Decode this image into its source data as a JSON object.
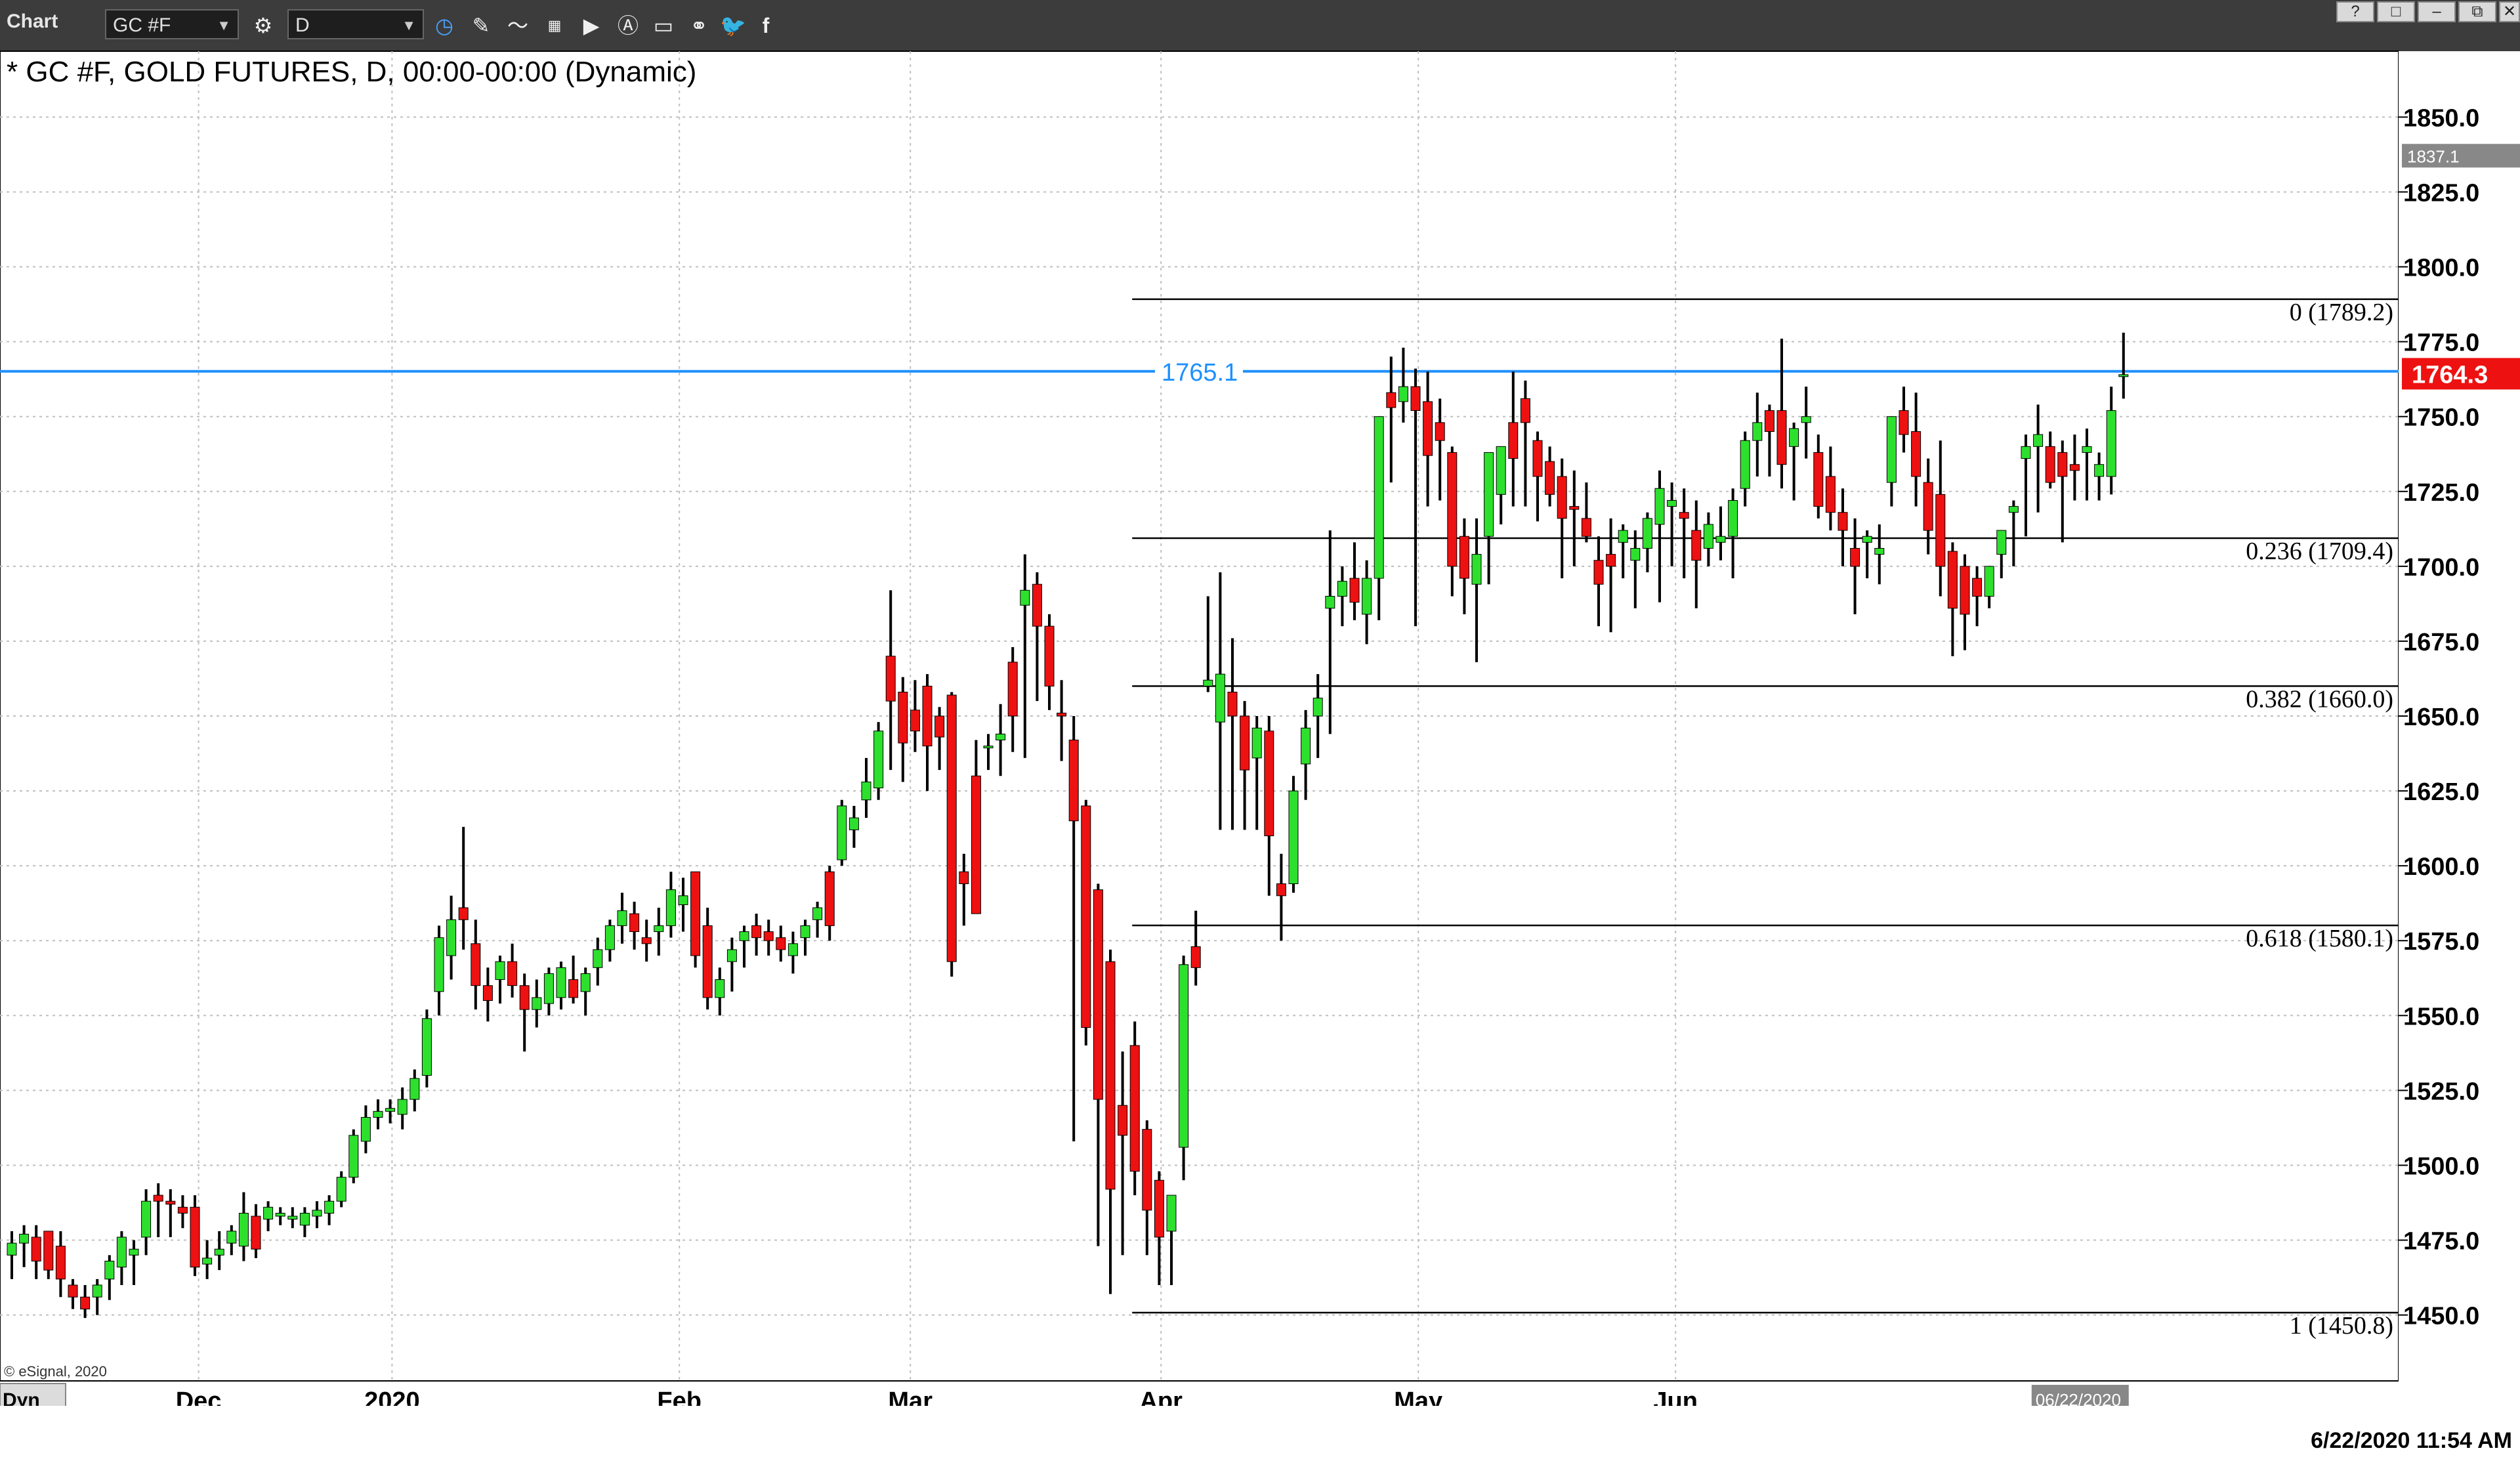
{
  "toolbar": {
    "title": "Chart",
    "symbol": "GC #F",
    "interval": "D",
    "window_buttons": [
      "?",
      "□",
      "–",
      "⧉",
      "▭",
      "✕"
    ]
  },
  "chart_header": "* GC #F, GOLD FUTURES, D, 00:00-00:00 (Dynamic)",
  "copyright": "© eSignal, 2020",
  "corner_label": "Dyn",
  "timestamp": "6/22/2020 11:54 AM",
  "colors": {
    "up": "#2ee02e",
    "down": "#ee1111",
    "wick": "#000000",
    "grid": "#bfbfbf",
    "hline": "#1e90ff",
    "price_tag": "#ee1111",
    "toolbar": "#3c3c3c"
  },
  "chart_data": {
    "type": "candlestick",
    "title": "* GC #F, GOLD FUTURES, D, 00:00-00:00 (Dynamic)",
    "x_labels": [
      "Dec",
      "2020",
      "Feb",
      "Mar",
      "Apr",
      "May",
      "Jun"
    ],
    "cursor_date_label": "06/22/2020",
    "y_ticks": [
      1450,
      1475,
      1500,
      1525,
      1550,
      1575,
      1600,
      1625,
      1650,
      1675,
      1700,
      1725,
      1750,
      1775,
      1800,
      1825,
      1850
    ],
    "y_tick_labels": [
      "1450.0",
      "1475.0",
      "1500.0",
      "1525.0",
      "1550.0",
      "1575.0",
      "1600.0",
      "1625.0",
      "1650.0",
      "1675.0",
      "1700.0",
      "1725.0",
      "1750.0",
      "1775.0",
      "1800.0",
      "1825.0",
      "1850.0"
    ],
    "ylim": [
      1428,
      1872
    ],
    "grid": true,
    "horizontal_line": {
      "value": 1765.1,
      "label": "1765.1"
    },
    "prior_close": {
      "value": 1837.1,
      "label": "1837.1"
    },
    "last_price": {
      "value": 1764.3,
      "label": "1764.3"
    },
    "fibonacci": [
      {
        "level": "0",
        "value": 1789.2,
        "label": "0 (1789.2)"
      },
      {
        "level": "0.236",
        "value": 1709.4,
        "label": "0.236 (1709.4)"
      },
      {
        "level": "0.382",
        "value": 1660.0,
        "label": "0.382 (1660.0)"
      },
      {
        "level": "0.618",
        "value": 1580.1,
        "label": "0.618 (1580.1)"
      },
      {
        "level": "1",
        "value": 1450.8,
        "label": "1 (1450.8)"
      }
    ],
    "candles": [
      [
        1470,
        1478,
        1462,
        1474
      ],
      [
        1474,
        1480,
        1466,
        1477
      ],
      [
        1476,
        1480,
        1462,
        1468
      ],
      [
        1478,
        1478,
        1462,
        1465
      ],
      [
        1473,
        1478,
        1456,
        1462
      ],
      [
        1460,
        1462,
        1452,
        1456
      ],
      [
        1456,
        1460,
        1449,
        1452
      ],
      [
        1456,
        1462,
        1450,
        1460
      ],
      [
        1462,
        1470,
        1455,
        1468
      ],
      [
        1466,
        1478,
        1460,
        1476
      ],
      [
        1470,
        1475,
        1460,
        1472
      ],
      [
        1476,
        1492,
        1470,
        1488
      ],
      [
        1490,
        1494,
        1476,
        1488
      ],
      [
        1488,
        1492,
        1476,
        1487
      ],
      [
        1486,
        1490,
        1479,
        1484
      ],
      [
        1486,
        1490,
        1463,
        1466
      ],
      [
        1467,
        1475,
        1462,
        1469
      ],
      [
        1470,
        1478,
        1465,
        1472
      ],
      [
        1474,
        1480,
        1470,
        1478
      ],
      [
        1473,
        1491,
        1468,
        1484
      ],
      [
        1483,
        1487,
        1469,
        1472
      ],
      [
        1482,
        1488,
        1478,
        1486
      ],
      [
        1483,
        1486,
        1480,
        1484
      ],
      [
        1482,
        1486,
        1479,
        1483
      ],
      [
        1480,
        1486,
        1476,
        1484
      ],
      [
        1483,
        1488,
        1479,
        1485
      ],
      [
        1484,
        1490,
        1480,
        1488
      ],
      [
        1488,
        1498,
        1486,
        1496
      ],
      [
        1496,
        1512,
        1494,
        1510
      ],
      [
        1508,
        1520,
        1504,
        1516
      ],
      [
        1516,
        1522,
        1512,
        1518
      ],
      [
        1518,
        1522,
        1514,
        1519
      ],
      [
        1517,
        1526,
        1512,
        1522
      ],
      [
        1522,
        1532,
        1518,
        1529
      ],
      [
        1530,
        1552,
        1526,
        1549
      ],
      [
        1558,
        1580,
        1550,
        1576
      ],
      [
        1570,
        1590,
        1562,
        1582
      ],
      [
        1586,
        1613,
        1572,
        1582
      ],
      [
        1574,
        1582,
        1552,
        1560
      ],
      [
        1560,
        1566,
        1548,
        1555
      ],
      [
        1562,
        1570,
        1554,
        1568
      ],
      [
        1568,
        1574,
        1556,
        1560
      ],
      [
        1560,
        1564,
        1538,
        1552
      ],
      [
        1552,
        1562,
        1546,
        1556
      ],
      [
        1554,
        1566,
        1550,
        1564
      ],
      [
        1556,
        1568,
        1552,
        1566
      ],
      [
        1562,
        1570,
        1554,
        1556
      ],
      [
        1558,
        1566,
        1550,
        1564
      ],
      [
        1566,
        1576,
        1560,
        1572
      ],
      [
        1572,
        1582,
        1568,
        1580
      ],
      [
        1580,
        1591,
        1574,
        1585
      ],
      [
        1584,
        1588,
        1572,
        1578
      ],
      [
        1576,
        1582,
        1568,
        1574
      ],
      [
        1578,
        1586,
        1570,
        1580
      ],
      [
        1580,
        1598,
        1576,
        1592
      ],
      [
        1587,
        1596,
        1578,
        1590
      ],
      [
        1598,
        1598,
        1566,
        1570
      ],
      [
        1580,
        1586,
        1552,
        1556
      ],
      [
        1556,
        1566,
        1550,
        1562
      ],
      [
        1568,
        1576,
        1558,
        1572
      ],
      [
        1575,
        1580,
        1566,
        1578
      ],
      [
        1580,
        1584,
        1570,
        1576
      ],
      [
        1578,
        1582,
        1570,
        1575
      ],
      [
        1576,
        1580,
        1568,
        1572
      ],
      [
        1570,
        1578,
        1564,
        1574
      ],
      [
        1576,
        1582,
        1570,
        1580
      ],
      [
        1582,
        1588,
        1576,
        1586
      ],
      [
        1598,
        1600,
        1575,
        1580
      ],
      [
        1602,
        1622,
        1600,
        1620
      ],
      [
        1612,
        1620,
        1606,
        1616
      ],
      [
        1622,
        1636,
        1616,
        1628
      ],
      [
        1626,
        1648,
        1622,
        1645
      ],
      [
        1670,
        1692,
        1632,
        1655
      ],
      [
        1658,
        1663,
        1628,
        1641
      ],
      [
        1652,
        1662,
        1638,
        1645
      ],
      [
        1660,
        1664,
        1625,
        1640
      ],
      [
        1650,
        1653,
        1632,
        1643
      ],
      [
        1657,
        1658,
        1563,
        1568
      ],
      [
        1598,
        1604,
        1580,
        1594
      ],
      [
        1630,
        1642,
        1596,
        1584
      ],
      [
        1640,
        1644,
        1632,
        1640
      ],
      [
        1642,
        1654,
        1630,
        1644
      ],
      [
        1668,
        1673,
        1638,
        1650
      ],
      [
        1687,
        1704,
        1636,
        1692
      ],
      [
        1694,
        1698,
        1655,
        1680
      ],
      [
        1680,
        1684,
        1652,
        1660
      ],
      [
        1651,
        1662,
        1635,
        1650
      ],
      [
        1642,
        1650,
        1508,
        1615
      ],
      [
        1620,
        1622,
        1540,
        1546
      ],
      [
        1592,
        1594,
        1473,
        1522
      ],
      [
        1568,
        1572,
        1457,
        1492
      ],
      [
        1520,
        1538,
        1470,
        1510
      ],
      [
        1540,
        1548,
        1490,
        1498
      ],
      [
        1512,
        1515,
        1470,
        1485
      ],
      [
        1495,
        1498,
        1460,
        1476
      ],
      [
        1478,
        1488,
        1460,
        1490
      ],
      [
        1506,
        1570,
        1495,
        1567
      ],
      [
        1573,
        1585,
        1560,
        1566
      ],
      [
        1660,
        1690,
        1658,
        1662
      ],
      [
        1648,
        1698,
        1612,
        1664
      ],
      [
        1658,
        1676,
        1612,
        1650
      ],
      [
        1650,
        1655,
        1612,
        1632
      ],
      [
        1636,
        1650,
        1612,
        1646
      ],
      [
        1645,
        1650,
        1590,
        1610
      ],
      [
        1594,
        1604,
        1575,
        1590
      ],
      [
        1594,
        1630,
        1591,
        1625
      ],
      [
        1634,
        1652,
        1622,
        1646
      ],
      [
        1650,
        1664,
        1636,
        1656
      ],
      [
        1686,
        1712,
        1644,
        1690
      ],
      [
        1690,
        1700,
        1680,
        1695
      ],
      [
        1696,
        1708,
        1682,
        1688
      ],
      [
        1684,
        1702,
        1674,
        1696
      ],
      [
        1696,
        1745,
        1682,
        1750
      ],
      [
        1758,
        1770,
        1728,
        1753
      ],
      [
        1755,
        1773,
        1748,
        1760
      ],
      [
        1760,
        1766,
        1680,
        1752
      ],
      [
        1755,
        1765,
        1720,
        1737
      ],
      [
        1748,
        1756,
        1722,
        1742
      ],
      [
        1738,
        1740,
        1690,
        1700
      ],
      [
        1710,
        1716,
        1684,
        1696
      ],
      [
        1694,
        1716,
        1668,
        1704
      ],
      [
        1710,
        1734,
        1694,
        1738
      ],
      [
        1724,
        1738,
        1714,
        1740
      ],
      [
        1748,
        1765,
        1720,
        1736
      ],
      [
        1756,
        1762,
        1720,
        1748
      ],
      [
        1742,
        1745,
        1715,
        1730
      ],
      [
        1735,
        1740,
        1720,
        1724
      ],
      [
        1730,
        1736,
        1696,
        1716
      ],
      [
        1720,
        1732,
        1700,
        1719
      ],
      [
        1716,
        1728,
        1708,
        1710
      ],
      [
        1702,
        1710,
        1680,
        1694
      ],
      [
        1704,
        1716,
        1678,
        1700
      ],
      [
        1708,
        1714,
        1696,
        1712
      ],
      [
        1702,
        1712,
        1686,
        1706
      ],
      [
        1706,
        1718,
        1698,
        1716
      ],
      [
        1714,
        1732,
        1688,
        1726
      ],
      [
        1720,
        1728,
        1700,
        1722
      ],
      [
        1718,
        1726,
        1696,
        1716
      ],
      [
        1712,
        1722,
        1686,
        1702
      ],
      [
        1706,
        1718,
        1700,
        1714
      ],
      [
        1708,
        1720,
        1702,
        1710
      ],
      [
        1710,
        1726,
        1696,
        1722
      ],
      [
        1726,
        1745,
        1720,
        1742
      ],
      [
        1742,
        1758,
        1730,
        1748
      ],
      [
        1752,
        1754,
        1730,
        1745
      ],
      [
        1752,
        1776,
        1726,
        1734
      ],
      [
        1740,
        1748,
        1722,
        1746
      ],
      [
        1748,
        1760,
        1736,
        1750
      ],
      [
        1738,
        1744,
        1716,
        1720
      ],
      [
        1730,
        1740,
        1712,
        1718
      ],
      [
        1718,
        1726,
        1700,
        1712
      ],
      [
        1706,
        1716,
        1684,
        1700
      ],
      [
        1708,
        1712,
        1696,
        1710
      ],
      [
        1704,
        1714,
        1694,
        1706
      ],
      [
        1728,
        1748,
        1720,
        1750
      ],
      [
        1752,
        1760,
        1738,
        1744
      ],
      [
        1745,
        1758,
        1720,
        1730
      ],
      [
        1728,
        1736,
        1704,
        1712
      ],
      [
        1724,
        1742,
        1690,
        1700
      ],
      [
        1705,
        1708,
        1670,
        1686
      ],
      [
        1700,
        1704,
        1672,
        1684
      ],
      [
        1696,
        1700,
        1680,
        1690
      ],
      [
        1690,
        1698,
        1686,
        1700
      ],
      [
        1704,
        1708,
        1696,
        1712
      ],
      [
        1718,
        1722,
        1700,
        1720
      ],
      [
        1736,
        1744,
        1710,
        1740
      ],
      [
        1740,
        1754,
        1718,
        1744
      ],
      [
        1740,
        1745,
        1726,
        1728
      ],
      [
        1738,
        1742,
        1708,
        1730
      ],
      [
        1734,
        1744,
        1722,
        1732
      ],
      [
        1738,
        1746,
        1722,
        1740
      ],
      [
        1730,
        1738,
        1722,
        1734
      ],
      [
        1730,
        1760,
        1724,
        1752
      ],
      [
        1764,
        1778,
        1756,
        1764
      ]
    ]
  }
}
